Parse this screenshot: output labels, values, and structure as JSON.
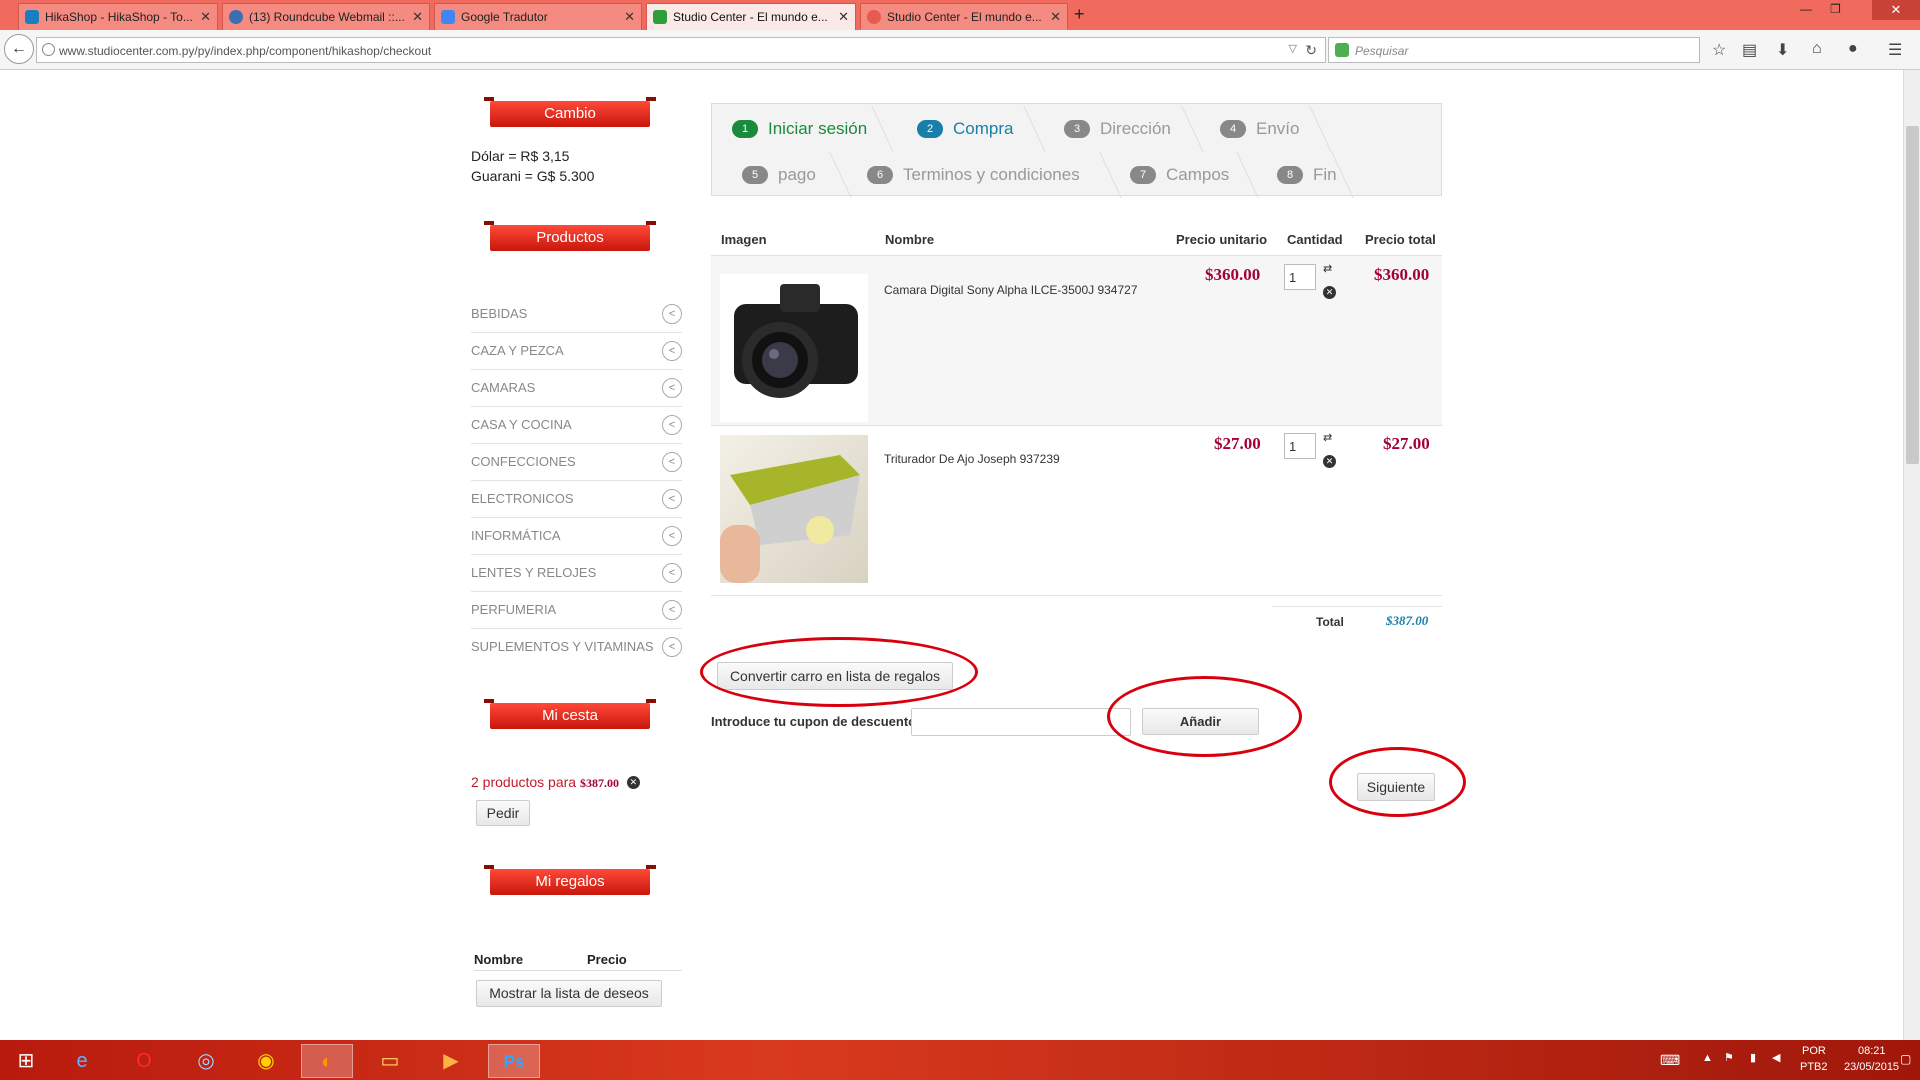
{
  "browser": {
    "tabs": [
      {
        "label": "HikaShop - HikaShop - To...",
        "icon": "joomla-icon",
        "color": "#1a7fc1"
      },
      {
        "label": "(13) Roundcube Webmail ::...",
        "icon": "roundcube-icon",
        "color": "#3a6fb0"
      },
      {
        "label": "Google Tradutor",
        "icon": "translate-icon",
        "color": "#4285f4"
      },
      {
        "label": "Studio Center - El mundo e...",
        "icon": "joomla-icon",
        "color": "#2e9e3a"
      },
      {
        "label": "Studio Center - El mundo e...",
        "icon": "loading-icon",
        "color": "#e65b4f"
      }
    ],
    "url": "www.studiocenter.com.py/py/index.php/component/hikashop/checkout",
    "search_placeholder": "Pesquisar"
  },
  "sidebar": {
    "cambio_title": "Cambio",
    "dolar": "Dólar = R$ 3,15",
    "guarani": "Guarani = G$ 5.300",
    "productos_title": "Productos",
    "categories": [
      "BEBIDAS",
      "CAZA Y PEZCA",
      "CAMARAS",
      "CASA Y COCINA",
      "CONFECCIONES",
      "ELECTRONICOS",
      "INFORMÁTICA",
      "LENTES Y RELOJES",
      "PERFUMERIA",
      "SUPLEMENTOS Y VITAMINAS"
    ],
    "cesta_title": "Mi cesta",
    "cesta_text": "2 productos para",
    "cesta_amount": "$387.00",
    "pedir": "Pedir",
    "regalos_title": "Mi regalos",
    "col_nombre": "Nombre",
    "col_precio": "Precio",
    "mostrar": "Mostrar la lista de deseos"
  },
  "steps": [
    {
      "num": "1",
      "label": "Iniciar sesión"
    },
    {
      "num": "2",
      "label": "Compra"
    },
    {
      "num": "3",
      "label": "Dirección"
    },
    {
      "num": "4",
      "label": "Envío"
    },
    {
      "num": "5",
      "label": "pago"
    },
    {
      "num": "6",
      "label": "Terminos y condiciones"
    },
    {
      "num": "7",
      "label": "Campos"
    },
    {
      "num": "8",
      "label": "Fin"
    }
  ],
  "cart": {
    "headers": {
      "imagen": "Imagen",
      "nombre": "Nombre",
      "unit": "Precio unitario",
      "qty": "Cantidad",
      "total": "Precio total"
    },
    "items": [
      {
        "name": "Camara Digital Sony Alpha ILCE-3500J 934727",
        "unit": "$360.00",
        "qty": "1",
        "total": "$360.00"
      },
      {
        "name": "Triturador De Ajo Joseph 937239",
        "unit": "$27.00",
        "qty": "1",
        "total": "$27.00"
      }
    ],
    "total_label": "Total",
    "total_value": "$387.00",
    "convert_label": "Convertir carro en lista de regalos",
    "coupon_label": "Introduce tu cupon de descuento",
    "add_label": "Añadir",
    "next_label": "Siguiente"
  },
  "taskbar": {
    "lang": "POR",
    "layout": "PTB2",
    "time": "08:21",
    "date": "23/05/2015"
  }
}
